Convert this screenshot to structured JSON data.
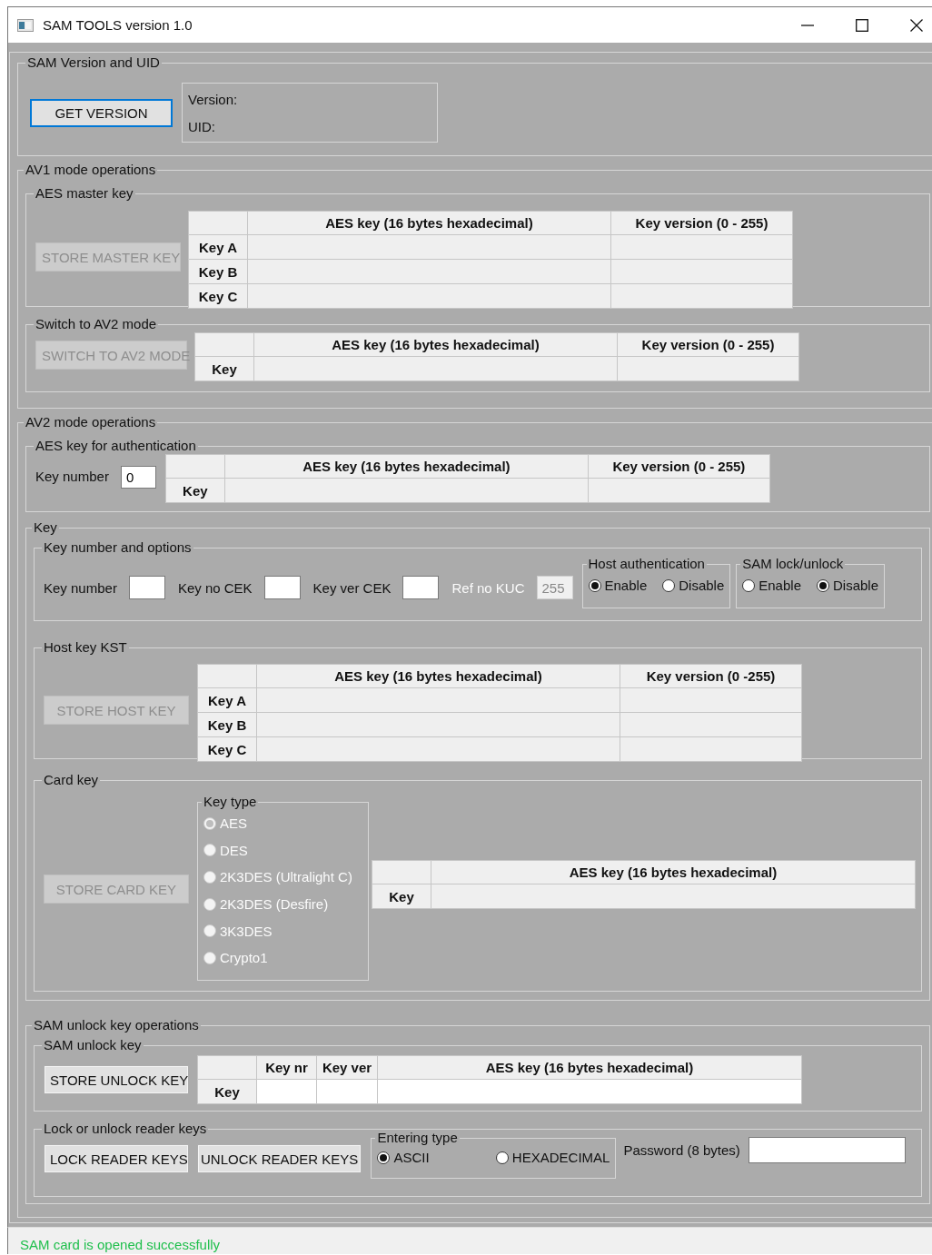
{
  "window": {
    "title": "SAM TOOLS version 1.0"
  },
  "version_group": {
    "title": "SAM Version and UID",
    "button": {
      "label": "GET VERSION",
      "disabled": false,
      "focused": true
    },
    "version_label": "Version:",
    "uid_label": "UID:"
  },
  "av1": {
    "title": "AV1 mode operations",
    "master_key": {
      "title": "AES master key",
      "button": {
        "label": "STORE MASTER KEY",
        "disabled": true
      },
      "table": {
        "editable": false,
        "columns": [
          "AES key (16 bytes hexadecimal)",
          "Key version (0 - 255)"
        ],
        "rows": [
          "Key A",
          "Key B",
          "Key C"
        ]
      }
    },
    "switch": {
      "title": "Switch to AV2 mode",
      "button": {
        "label": "SWITCH TO AV2 MODE",
        "disabled": true
      },
      "table": {
        "editable": false,
        "columns": [
          "AES key (16 bytes hexadecimal)",
          "Key version (0 - 255)"
        ],
        "rows": [
          "Key"
        ]
      }
    }
  },
  "av2": {
    "title": "AV2 mode operations",
    "auth": {
      "title": "AES key for authentication",
      "key_number_label": "Key number",
      "key_number_value": "0",
      "table": {
        "editable": false,
        "columns": [
          "AES key (16 bytes hexadecimal)",
          "Key version (0 - 255)"
        ],
        "rows": [
          "Key"
        ]
      }
    },
    "key": {
      "title": "Key",
      "options": {
        "title": "Key number and options",
        "fields": [
          {
            "label": "Key number",
            "disabled": false
          },
          {
            "label": "Key no CEK",
            "disabled": false
          },
          {
            "label": "Key ver CEK",
            "disabled": false
          },
          {
            "label": "Ref no KUC",
            "value": "255",
            "disabled": true
          }
        ],
        "host_auth": {
          "title": "Host authentication",
          "options": [
            {
              "label": "Enable",
              "selected": true
            },
            {
              "label": "Disable",
              "selected": false
            }
          ]
        },
        "sam_lock": {
          "title": "SAM lock/unlock",
          "options": [
            {
              "label": "Enable",
              "selected": false
            },
            {
              "label": "Disable",
              "selected": true
            }
          ]
        }
      },
      "host_key": {
        "title": "Host key KST",
        "button": {
          "label": "STORE HOST KEY",
          "disabled": true
        },
        "table": {
          "editable": false,
          "columns": [
            "AES key (16 bytes hexadecimal)",
            "Key version (0 -255)"
          ],
          "rows": [
            "Key A",
            "Key B",
            "Key C"
          ]
        }
      },
      "card_key": {
        "title": "Card key",
        "button": {
          "label": "STORE CARD KEY",
          "disabled": true
        },
        "key_type": {
          "title": "Key type",
          "disabled": true,
          "options": [
            {
              "label": "AES",
              "selected": true
            },
            {
              "label": "DES",
              "selected": false
            },
            {
              "label": "2K3DES (Ultralight C)",
              "selected": false
            },
            {
              "label": "2K3DES (Desfire)",
              "selected": false
            },
            {
              "label": "3K3DES",
              "selected": false
            },
            {
              "label": "Crypto1",
              "selected": false
            }
          ]
        },
        "table": {
          "editable": false,
          "columns": [
            "AES key (16 bytes hexadecimal)"
          ],
          "rows": [
            "Key"
          ]
        }
      }
    },
    "unlock": {
      "title": "SAM unlock key operations",
      "unlock_key": {
        "title": "SAM unlock key",
        "button": {
          "label": "STORE UNLOCK KEY",
          "disabled": false
        },
        "table": {
          "editable": true,
          "columns": [
            "Key nr",
            "Key ver",
            "AES key (16 bytes hexadecimal)"
          ],
          "rows": [
            "Key"
          ]
        }
      },
      "reader_keys": {
        "title": "Lock or unlock reader keys",
        "buttons": [
          {
            "label": "LOCK READER KEYS",
            "disabled": false
          },
          {
            "label": "UNLOCK READER KEYS",
            "disabled": false
          }
        ],
        "entering_type": {
          "title": "Entering type",
          "options": [
            {
              "label": "ASCII",
              "selected": true
            },
            {
              "label": "HEXADECIMAL",
              "selected": false
            }
          ]
        },
        "password_label": "Password (8 bytes)"
      }
    }
  },
  "status_bar": {
    "text": "SAM card is opened successfully"
  }
}
